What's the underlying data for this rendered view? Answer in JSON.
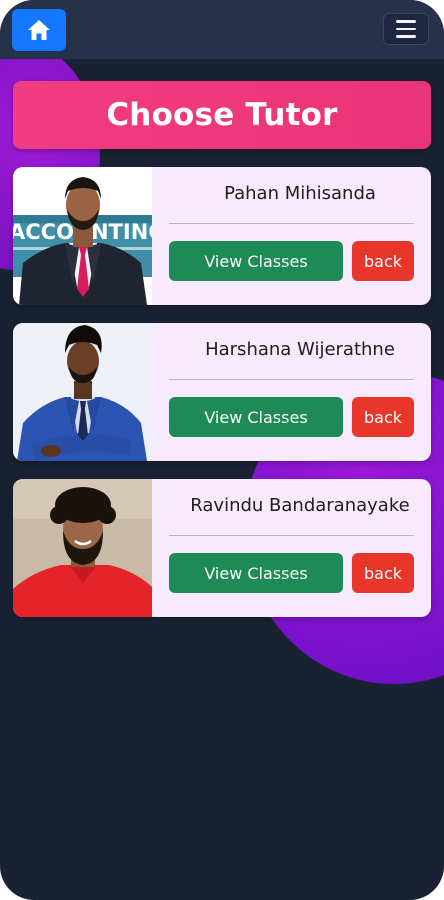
{
  "navbar": {
    "home_icon": "home-icon",
    "menu_icon": "hamburger-menu-icon"
  },
  "header": {
    "title": "Choose Tutor"
  },
  "tutors": [
    {
      "name": "Pahan Mihisanda",
      "view_label": "View Classes",
      "back_label": "back",
      "photo_sign_text": "ACCOUNTING"
    },
    {
      "name": "Harshana Wijerathne",
      "view_label": "View Classes",
      "back_label": "back"
    },
    {
      "name": "Ravindu Bandaranayake",
      "view_label": "View Classes",
      "back_label": "back"
    }
  ],
  "colors": {
    "background": "#192233",
    "navbar": "#25324a",
    "home_button": "#1677ff",
    "banner": "#ee3a7f",
    "card": "#f6eafc",
    "view_button": "#1e8a55",
    "back_button": "#e8372a",
    "decorative_blob": "#8a16cf"
  }
}
